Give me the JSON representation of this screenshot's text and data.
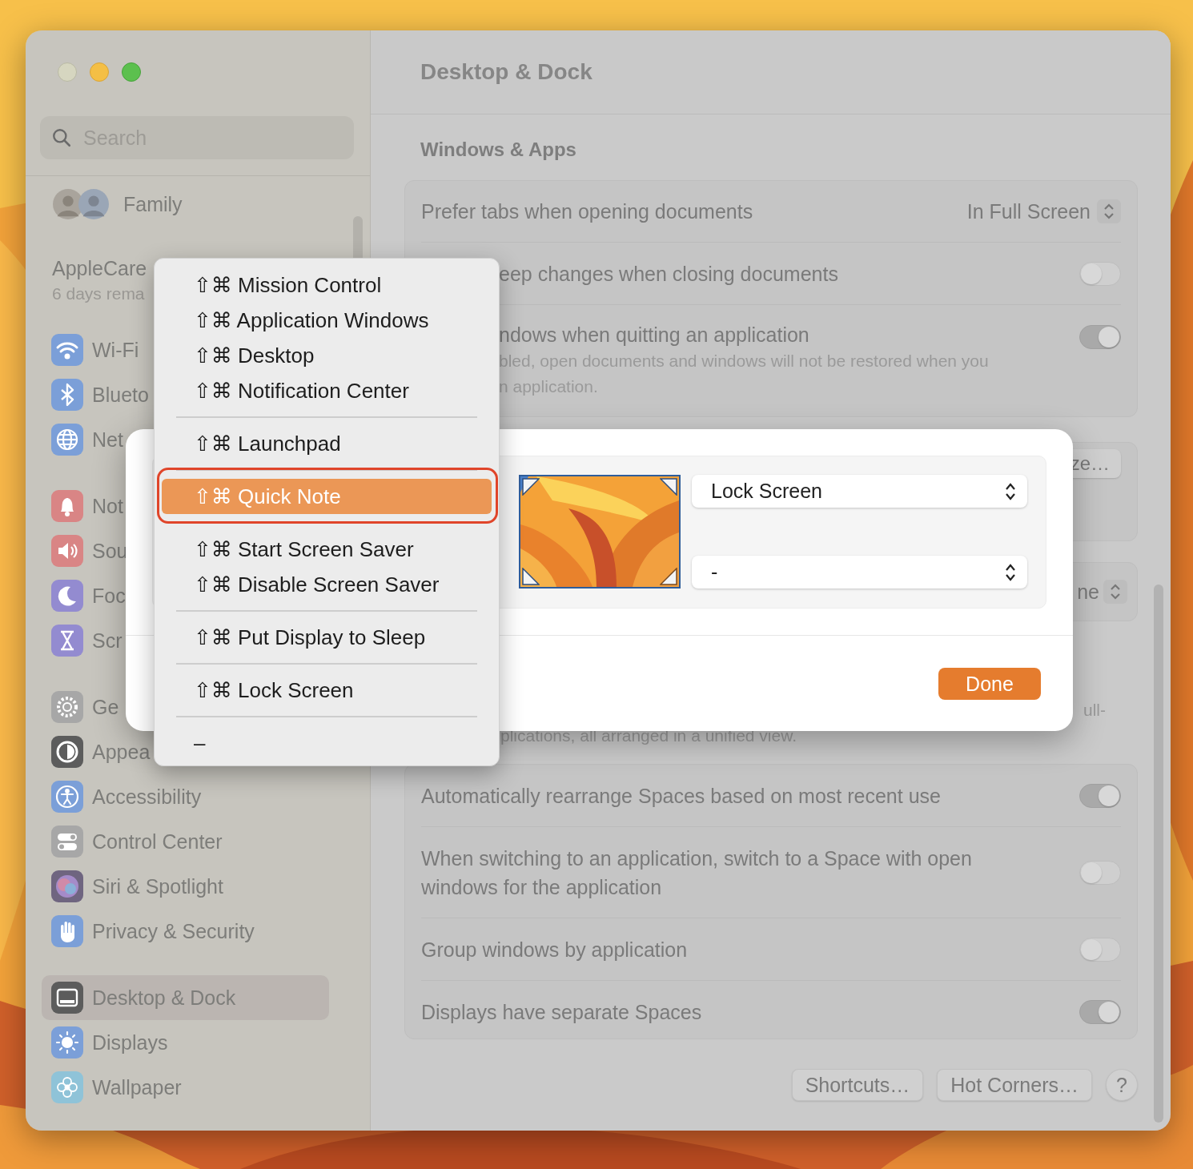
{
  "sidebar": {
    "search": {
      "placeholder": "Search"
    },
    "account": {
      "label": "Family"
    },
    "applecare": {
      "title": "AppleCare",
      "subtitle": "6 days rema"
    },
    "groups": [
      [
        {
          "label": "Wi-Fi",
          "kind": "wifi",
          "color": "#7b9fd8",
          "selected": false
        },
        {
          "label": "Blueto",
          "kind": "bluetooth",
          "color": "#7b9fd8",
          "selected": false
        },
        {
          "label": "Net",
          "kind": "globe",
          "color": "#7b9fd8",
          "selected": false
        }
      ],
      [
        {
          "label": "Not",
          "kind": "bell",
          "color": "#d98585",
          "selected": false
        },
        {
          "label": "Sou",
          "kind": "speaker",
          "color": "#d98585",
          "selected": false
        },
        {
          "label": "Foc",
          "kind": "moon",
          "color": "#938bd0",
          "selected": false
        },
        {
          "label": "Scr",
          "kind": "hourglass",
          "color": "#938bd0",
          "selected": false
        }
      ],
      [
        {
          "label": "Ge",
          "kind": "gear",
          "color": "#a7a7a7",
          "selected": false
        },
        {
          "label": "Appea",
          "kind": "contrast",
          "color": "#5c5c5c",
          "selected": false
        },
        {
          "label": "Accessibility",
          "kind": "accessibility",
          "color": "#7b9fd8",
          "selected": false
        },
        {
          "label": "Control Center",
          "kind": "toggles",
          "color": "#a7a7a7",
          "selected": false
        },
        {
          "label": "Siri & Spotlight",
          "kind": "orb",
          "color": "#6f6580",
          "selected": false
        },
        {
          "label": "Privacy & Security",
          "kind": "hand",
          "color": "#7b9fd8",
          "selected": false
        }
      ],
      [
        {
          "label": "Desktop & Dock",
          "kind": "window",
          "color": "#5c5c5c",
          "selected": true
        },
        {
          "label": "Displays",
          "kind": "sun",
          "color": "#7b9fd8",
          "selected": false
        },
        {
          "label": "Wallpaper",
          "kind": "flower",
          "color": "#8fc3d8",
          "selected": false
        }
      ]
    ]
  },
  "content": {
    "title": "Desktop & Dock",
    "section": "Windows & Apps",
    "windows_group": [
      {
        "kind": "popup",
        "label": "Prefer tabs when opening documents",
        "value": "In Full Screen"
      },
      {
        "kind": "toggle",
        "label": "eep changes when closing documents",
        "on": false
      },
      {
        "kind": "toggle",
        "label": "ndows when quitting an application",
        "description": [
          "bled, open documents and windows will not be restored when you",
          "n application."
        ],
        "on": true
      }
    ],
    "partial": {
      "button": "ze…",
      "popup_value": "ne",
      "description_end": "ull-",
      "description_line": "plications, all arranged in a unified view."
    },
    "spaces_group": [
      {
        "kind": "toggle",
        "label": "Automatically rearrange Spaces based on most recent use",
        "on": true
      },
      {
        "kind": "toggle",
        "label": "When switching to an application, switch to a Space with open windows for the application",
        "on": false
      },
      {
        "kind": "toggle",
        "label": "Group windows by application",
        "on": false
      },
      {
        "kind": "toggle",
        "label": "Displays have separate Spaces",
        "on": true
      }
    ],
    "footer_buttons": [
      {
        "kind": "text",
        "label": "Shortcuts…"
      },
      {
        "kind": "text",
        "label": "Hot Corners…"
      },
      {
        "kind": "help",
        "label": "?"
      }
    ]
  },
  "dialog": {
    "corners": [
      {
        "value": "Lock Screen"
      },
      {
        "value": "-"
      }
    ],
    "button": "Done"
  },
  "menu": {
    "sections": [
      [
        {
          "label": "⇧⌘ Mission Control",
          "selected": false
        },
        {
          "label": "⇧⌘ Application Windows",
          "selected": false
        },
        {
          "label": "⇧⌘ Desktop",
          "selected": false
        },
        {
          "label": "⇧⌘ Notification Center",
          "selected": false
        }
      ],
      [
        {
          "label": "⇧⌘ Launchpad",
          "selected": false
        }
      ],
      [
        {
          "label": "⇧⌘ Quick Note",
          "selected": true
        }
      ],
      [
        {
          "label": "⇧⌘ Start Screen Saver",
          "selected": false
        },
        {
          "label": "⇧⌘ Disable Screen Saver",
          "selected": false
        }
      ],
      [
        {
          "label": "⇧⌘ Put Display to Sleep",
          "selected": false
        }
      ],
      [
        {
          "label": "⇧⌘ Lock Screen",
          "selected": false
        }
      ],
      [
        {
          "label": "–",
          "selected": false
        }
      ]
    ]
  }
}
